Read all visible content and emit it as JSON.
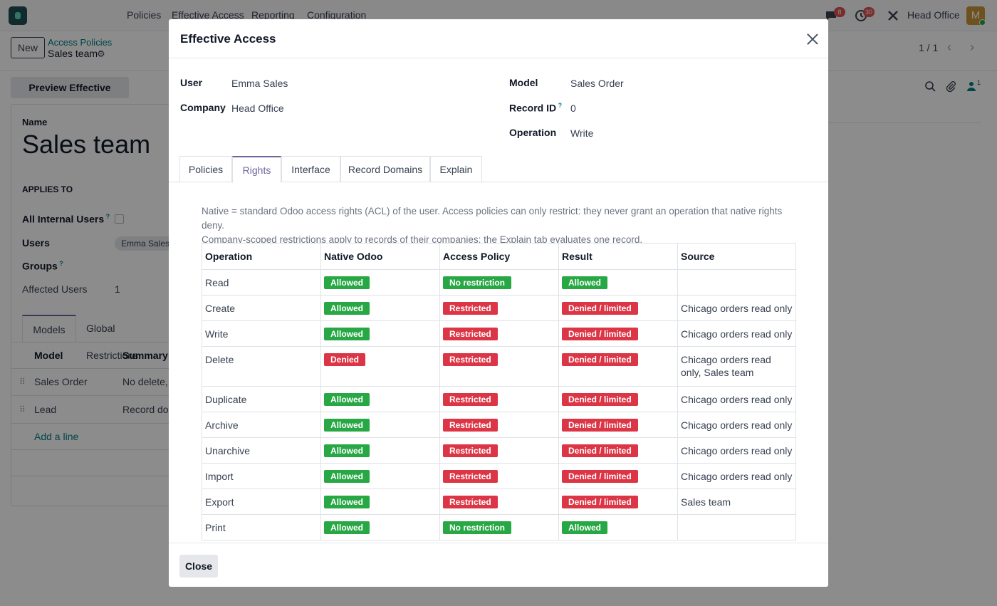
{
  "navbar": {
    "menu": [
      "Policies",
      "Effective Access",
      "Reporting",
      "Configuration"
    ],
    "messages_count": "8",
    "activities_count": "30",
    "company": "Head Office",
    "avatar_letter": "M"
  },
  "control": {
    "new_label": "New",
    "breadcrumb_parent": "Access Policies",
    "breadcrumb_current": "Sales team",
    "pager": "1 / 1",
    "preview_label": "Preview Effective Access",
    "followers_count": "1"
  },
  "form": {
    "name_label": "Name",
    "name_value": "Sales team",
    "applies_to_label": "APPLIES TO",
    "all_internal_users_label": "All Internal Users",
    "users_label": "Users",
    "user_tag": "Emma Sales",
    "groups_label": "Groups",
    "affected_users_label": "Affected Users",
    "affected_users_value": "1",
    "tabs": [
      "Models",
      "Global Restrictions"
    ],
    "columns": [
      "Model",
      "Summary"
    ],
    "rows": [
      {
        "model": "Sales Order",
        "summary": "No delete,"
      },
      {
        "model": "Lead",
        "summary": "Record dor"
      }
    ],
    "add_line": "Add a line"
  },
  "modal": {
    "title": "Effective Access",
    "fields": {
      "user_label": "User",
      "user_value": "Emma Sales",
      "company_label": "Company",
      "company_value": "Head Office",
      "model_label": "Model",
      "model_value": "Sales Order",
      "record_id_label": "Record ID",
      "record_id_value": "0",
      "operation_label": "Operation",
      "operation_value": "Write"
    },
    "tabs": [
      "Policies",
      "Rights",
      "Interface",
      "Record Domains",
      "Explain"
    ],
    "active_tab": "Rights",
    "description_1": "Native = standard Odoo access rights (ACL) of the user. Access policies can only restrict: they never grant an operation that native rights deny.",
    "description_2": "Company-scoped restrictions apply to records of their companies; the Explain tab evaluates one record.",
    "table": {
      "headers": [
        "Operation",
        "Native Odoo",
        "Access Policy",
        "Result",
        "Source"
      ],
      "rows": [
        {
          "operation": "Read",
          "native": "Allowed",
          "native_ok": true,
          "policy": "No restriction",
          "policy_ok": true,
          "result": "Allowed",
          "result_ok": true,
          "source": ""
        },
        {
          "operation": "Create",
          "native": "Allowed",
          "native_ok": true,
          "policy": "Restricted",
          "policy_ok": false,
          "result": "Denied / limited",
          "result_ok": false,
          "source": "Chicago orders read only"
        },
        {
          "operation": "Write",
          "native": "Allowed",
          "native_ok": true,
          "policy": "Restricted",
          "policy_ok": false,
          "result": "Denied / limited",
          "result_ok": false,
          "source": "Chicago orders read only"
        },
        {
          "operation": "Delete",
          "native": "Denied",
          "native_ok": false,
          "policy": "Restricted",
          "policy_ok": false,
          "result": "Denied / limited",
          "result_ok": false,
          "source": "Chicago orders read only, Sales team"
        },
        {
          "operation": "Duplicate",
          "native": "Allowed",
          "native_ok": true,
          "policy": "Restricted",
          "policy_ok": false,
          "result": "Denied / limited",
          "result_ok": false,
          "source": "Chicago orders read only"
        },
        {
          "operation": "Archive",
          "native": "Allowed",
          "native_ok": true,
          "policy": "Restricted",
          "policy_ok": false,
          "result": "Denied / limited",
          "result_ok": false,
          "source": "Chicago orders read only"
        },
        {
          "operation": "Unarchive",
          "native": "Allowed",
          "native_ok": true,
          "policy": "Restricted",
          "policy_ok": false,
          "result": "Denied / limited",
          "result_ok": false,
          "source": "Chicago orders read only"
        },
        {
          "operation": "Import",
          "native": "Allowed",
          "native_ok": true,
          "policy": "Restricted",
          "policy_ok": false,
          "result": "Denied / limited",
          "result_ok": false,
          "source": "Chicago orders read only"
        },
        {
          "operation": "Export",
          "native": "Allowed",
          "native_ok": true,
          "policy": "Restricted",
          "policy_ok": false,
          "result": "Denied / limited",
          "result_ok": false,
          "source": "Sales team"
        },
        {
          "operation": "Print",
          "native": "Allowed",
          "native_ok": true,
          "policy": "No restriction",
          "policy_ok": true,
          "result": "Allowed",
          "result_ok": true,
          "source": ""
        }
      ]
    },
    "close_label": "Close"
  },
  "colors": {
    "accent": "#71639e",
    "link": "#017e84",
    "allowed": "#28a745",
    "denied": "#dc3545"
  }
}
